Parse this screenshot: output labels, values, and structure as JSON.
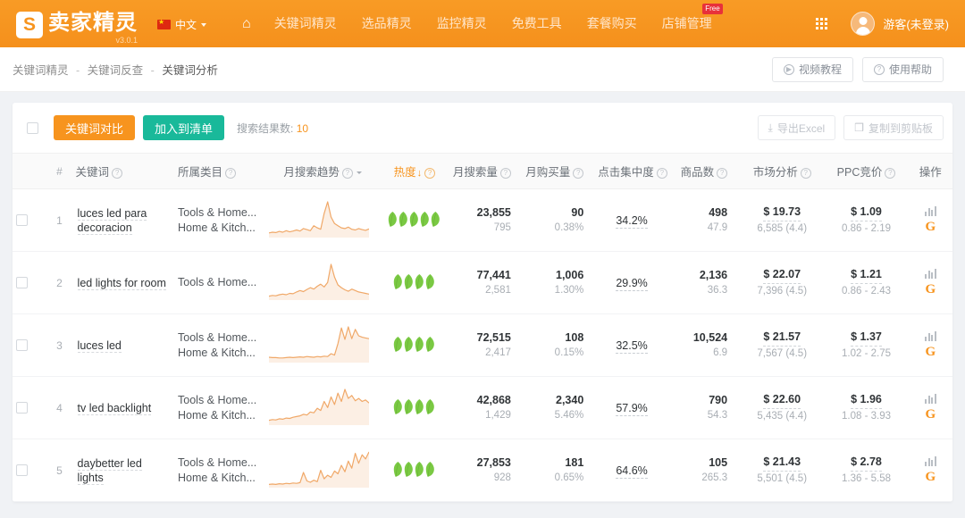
{
  "topnav": {
    "logo_mark": "S",
    "brand": "卖家精灵",
    "version": "v3.0.1",
    "language": "中文",
    "lang_icon": "cn-flag-icon",
    "home_icon": "home-icon",
    "links": [
      {
        "label": "关键词精灵",
        "badge": ""
      },
      {
        "label": "选品精灵",
        "badge": ""
      },
      {
        "label": "监控精灵",
        "badge": ""
      },
      {
        "label": "免费工具",
        "badge": ""
      },
      {
        "label": "套餐购买",
        "badge": ""
      },
      {
        "label": "店铺管理",
        "badge": "Free"
      }
    ],
    "apps_icon": "grid-apps-icon",
    "avatar_icon": "user-avatar-icon",
    "user": "游客(未登录)",
    "bg_color": "#f7941e"
  },
  "breadcrumb": {
    "items": [
      "关键词精灵",
      "关键词反查",
      "关键词分析"
    ],
    "separator": "-",
    "actions": [
      {
        "label": "视频教程",
        "icon": "play-circle-icon"
      },
      {
        "label": "使用帮助",
        "icon": "question-circle-icon"
      }
    ]
  },
  "toolbar": {
    "select_all_checkbox": "select-all",
    "compare_label": "关键词对比",
    "compare_color": "#f7941e",
    "add_list_label": "加入到清单",
    "add_list_color": "#19b99a",
    "result_prefix": "搜索结果数: ",
    "result_count": "10",
    "export_excel_label": "导出Excel",
    "export_icon": "download-icon",
    "copy_clipboard_label": "复制到剪贴板",
    "copy_icon": "clipboard-icon"
  },
  "table": {
    "headers": [
      {
        "label": "#",
        "help": false
      },
      {
        "label": "关键词",
        "help": true
      },
      {
        "label": "所属类目",
        "help": true
      },
      {
        "label": "月搜索趋势",
        "help": true,
        "caret": true
      },
      {
        "label": "热度",
        "help": true,
        "sorted": true,
        "arrow": "↓"
      },
      {
        "label": "月搜索量",
        "help": true
      },
      {
        "label": "月购买量",
        "help": true
      },
      {
        "label": "点击集中度",
        "help": true
      },
      {
        "label": "商品数",
        "help": true
      },
      {
        "label": "市场分析",
        "help": true
      },
      {
        "label": "PPC竞价",
        "help": true
      },
      {
        "label": "操作",
        "help": false
      }
    ],
    "rows": [
      {
        "index": "1",
        "keyword": "luces led para decoracion",
        "categories": [
          "Tools & Home...",
          "Home & Kitch..."
        ],
        "trend": [
          8,
          10,
          9,
          12,
          10,
          14,
          11,
          13,
          16,
          13,
          20,
          17,
          14,
          28,
          22,
          18,
          62,
          94,
          52,
          34,
          28,
          22,
          20,
          24,
          18,
          16,
          20,
          17,
          15,
          19
        ],
        "heat": 5,
        "search_volume": "23,855",
        "search_volume_sub": "795",
        "purchase": "90",
        "purchase_sub": "0.38%",
        "ctr": "34.2%",
        "products": "498",
        "products_sub": "47.9",
        "market_price": "$ 19.73",
        "market_sub": "6,585 (4.4)",
        "ppc": "$ 1.09",
        "ppc_sub": "0.86 - 2.19",
        "chart_icon": "bar-chart-icon",
        "google_icon": "google-g-icon"
      },
      {
        "index": "2",
        "keyword": "led lights for room",
        "categories": [
          "Tools & Home..."
        ],
        "trend": [
          6,
          8,
          7,
          10,
          12,
          10,
          14,
          13,
          18,
          22,
          19,
          25,
          30,
          26,
          34,
          40,
          32,
          45,
          96,
          60,
          38,
          30,
          24,
          20,
          26,
          22,
          18,
          16,
          14,
          12
        ],
        "heat": 4,
        "search_volume": "77,441",
        "search_volume_sub": "2,581",
        "purchase": "1,006",
        "purchase_sub": "1.30%",
        "ctr": "29.9%",
        "products": "2,136",
        "products_sub": "36.3",
        "market_price": "$ 22.07",
        "market_sub": "7,396 (4.5)",
        "ppc": "$ 1.21",
        "ppc_sub": "0.86 - 2.43",
        "chart_icon": "bar-chart-icon",
        "google_icon": "google-g-icon"
      },
      {
        "index": "3",
        "keyword": "luces led",
        "categories": [
          "Tools & Home...",
          "Home & Kitch..."
        ],
        "trend": [
          10,
          9,
          9,
          8,
          8,
          9,
          10,
          9,
          10,
          11,
          10,
          12,
          11,
          10,
          12,
          11,
          13,
          12,
          20,
          16,
          48,
          92,
          60,
          95,
          62,
          88,
          70,
          66,
          64,
          62
        ],
        "heat": 4,
        "search_volume": "72,515",
        "search_volume_sub": "2,417",
        "purchase": "108",
        "purchase_sub": "0.15%",
        "ctr": "32.5%",
        "products": "10,524",
        "products_sub": "6.9",
        "market_price": "$ 21.57",
        "market_sub": "7,567 (4.5)",
        "ppc": "$ 1.37",
        "ppc_sub": "1.02 - 2.75",
        "chart_icon": "bar-chart-icon",
        "google_icon": "google-g-icon"
      },
      {
        "index": "4",
        "keyword": "tv led backlight",
        "categories": [
          "Tools & Home...",
          "Home & Kitch..."
        ],
        "trend": [
          8,
          10,
          9,
          12,
          11,
          14,
          13,
          16,
          18,
          20,
          24,
          22,
          30,
          28,
          40,
          34,
          58,
          42,
          70,
          50,
          80,
          58,
          90,
          66,
          74,
          60,
          66,
          58,
          62,
          54
        ],
        "heat": 4,
        "search_volume": "42,868",
        "search_volume_sub": "1,429",
        "purchase": "2,340",
        "purchase_sub": "5.46%",
        "ctr": "57.9%",
        "products": "790",
        "products_sub": "54.3",
        "market_price": "$ 22.60",
        "market_sub": "5,435 (4.4)",
        "ppc": "$ 1.96",
        "ppc_sub": "1.08 - 3.93",
        "chart_icon": "bar-chart-icon",
        "google_icon": "google-g-icon"
      },
      {
        "index": "5",
        "keyword": "daybetter led lights",
        "categories": [
          "Tools & Home...",
          "Home & Kitch..."
        ],
        "trend": [
          4,
          5,
          4,
          6,
          5,
          7,
          6,
          8,
          7,
          9,
          38,
          14,
          10,
          16,
          12,
          44,
          20,
          30,
          24,
          42,
          34,
          58,
          40,
          70,
          50,
          92,
          64,
          88,
          76,
          96
        ],
        "heat": 4,
        "search_volume": "27,853",
        "search_volume_sub": "928",
        "purchase": "181",
        "purchase_sub": "0.65%",
        "ctr": "64.6%",
        "products": "105",
        "products_sub": "265.3",
        "market_price": "$ 21.43",
        "market_sub": "5,501 (4.5)",
        "ppc": "$ 2.78",
        "ppc_sub": "1.36 - 5.58",
        "chart_icon": "bar-chart-icon",
        "google_icon": "google-g-icon"
      }
    ]
  },
  "colors": {
    "accent": "#f7941e",
    "teal": "#19b99a",
    "leaf": "#7ac943",
    "trend_line": "#f0a868"
  }
}
